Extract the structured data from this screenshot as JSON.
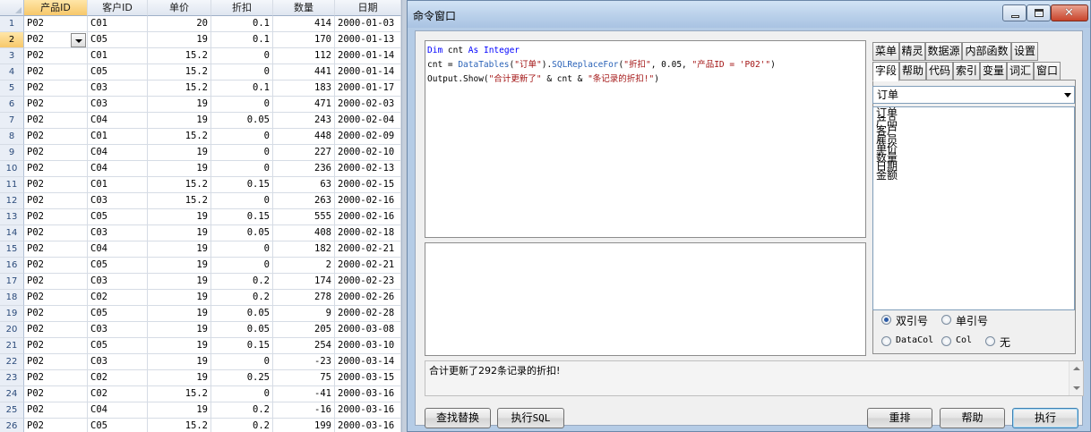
{
  "grid": {
    "columns": [
      "产品ID",
      "客户ID",
      "单价",
      "折扣",
      "数量",
      "日期"
    ],
    "active_column": 0,
    "current_row": 1,
    "rows": [
      [
        "1",
        "P02",
        "C01",
        "20",
        "0.1",
        "414",
        "2000-01-03"
      ],
      [
        "2",
        "P02",
        "C05",
        "19",
        "0.1",
        "170",
        "2000-01-13"
      ],
      [
        "3",
        "P02",
        "C01",
        "15.2",
        "0",
        "112",
        "2000-01-14"
      ],
      [
        "4",
        "P02",
        "C05",
        "15.2",
        "0",
        "441",
        "2000-01-14"
      ],
      [
        "5",
        "P02",
        "C03",
        "15.2",
        "0.1",
        "183",
        "2000-01-17"
      ],
      [
        "6",
        "P02",
        "C03",
        "19",
        "0",
        "471",
        "2000-02-03"
      ],
      [
        "7",
        "P02",
        "C04",
        "19",
        "0.05",
        "243",
        "2000-02-04"
      ],
      [
        "8",
        "P02",
        "C01",
        "15.2",
        "0",
        "448",
        "2000-02-09"
      ],
      [
        "9",
        "P02",
        "C04",
        "19",
        "0",
        "227",
        "2000-02-10"
      ],
      [
        "10",
        "P02",
        "C04",
        "19",
        "0",
        "236",
        "2000-02-13"
      ],
      [
        "11",
        "P02",
        "C01",
        "15.2",
        "0.15",
        "63",
        "2000-02-15"
      ],
      [
        "12",
        "P02",
        "C03",
        "15.2",
        "0",
        "263",
        "2000-02-16"
      ],
      [
        "13",
        "P02",
        "C05",
        "19",
        "0.15",
        "555",
        "2000-02-16"
      ],
      [
        "14",
        "P02",
        "C03",
        "19",
        "0.05",
        "408",
        "2000-02-18"
      ],
      [
        "15",
        "P02",
        "C04",
        "19",
        "0",
        "182",
        "2000-02-21"
      ],
      [
        "16",
        "P02",
        "C05",
        "19",
        "0",
        "2",
        "2000-02-21"
      ],
      [
        "17",
        "P02",
        "C03",
        "19",
        "0.2",
        "174",
        "2000-02-23"
      ],
      [
        "18",
        "P02",
        "C02",
        "19",
        "0.2",
        "278",
        "2000-02-26"
      ],
      [
        "19",
        "P02",
        "C05",
        "19",
        "0.05",
        "9",
        "2000-02-28"
      ],
      [
        "20",
        "P02",
        "C03",
        "19",
        "0.05",
        "205",
        "2000-03-08"
      ],
      [
        "21",
        "P02",
        "C05",
        "19",
        "0.15",
        "254",
        "2000-03-10"
      ],
      [
        "22",
        "P02",
        "C03",
        "19",
        "0",
        "-23",
        "2000-03-14"
      ],
      [
        "23",
        "P02",
        "C02",
        "19",
        "0.25",
        "75",
        "2000-03-15"
      ],
      [
        "24",
        "P02",
        "C02",
        "15.2",
        "0",
        "-41",
        "2000-03-16"
      ],
      [
        "25",
        "P02",
        "C04",
        "19",
        "0.2",
        "-16",
        "2000-03-16"
      ],
      [
        "26",
        "P02",
        "C05",
        "15.2",
        "0.2",
        "199",
        "2000-03-16"
      ]
    ]
  },
  "window": {
    "title": "命令窗口",
    "close_glyph": "✕"
  },
  "code": {
    "l1_kw1": "Dim",
    "l1_a": " cnt ",
    "l1_kw2": "As",
    "l1_sp": " ",
    "l1_kw3": "Integer",
    "l2_a": "cnt = ",
    "l2_obj": "DataTables",
    "l2_b": "(",
    "l2_s1": "\"订单\"",
    "l2_c": ").",
    "l2_obj2": "SQLReplaceFor",
    "l2_d": "(",
    "l2_s2": "\"折扣\"",
    "l2_e": ", 0.05, ",
    "l2_s3": "\"产品ID = 'P02'\"",
    "l2_f": ")",
    "l3_a": "Output.Show(",
    "l3_s1": "\"合计更新了\"",
    "l3_b": " & cnt & ",
    "l3_s2": "\"条记录的折扣!\"",
    "l3_c": ")"
  },
  "result_text": "合计更新了292条记录的折扣!",
  "tabs_row1": [
    "菜单",
    "精灵",
    "数据源",
    "内部函数",
    "设置"
  ],
  "tabs_row2": [
    "字段",
    "帮助",
    "代码",
    "索引",
    "变量",
    "词汇",
    "窗口"
  ],
  "selected_tab": "字段",
  "table_select": "订单",
  "fields": [
    "订单",
    "产品",
    "客户",
    "雇员",
    "单价",
    "数量",
    "日期",
    "金额"
  ],
  "radios": {
    "double_quote": "双引号",
    "single_quote": "单引号",
    "datacol": "DataCol",
    "col": "Col",
    "none": "无",
    "checked": "double_quote"
  },
  "buttons": {
    "find_replace": "查找替换",
    "exec_sql_prefix": "执行",
    "exec_sql_suffix": "SQL",
    "reorder": "重排",
    "help": "帮助",
    "run": "执行"
  }
}
